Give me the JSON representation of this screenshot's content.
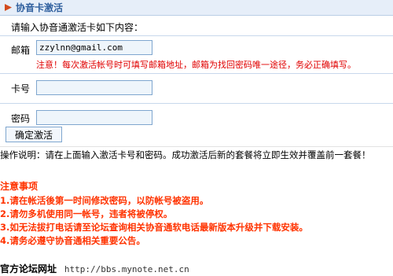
{
  "header": {
    "title": "协音卡激活"
  },
  "form": {
    "intro": "请输入协音通激活卡如下内容：",
    "email_label": "邮箱",
    "email_value": "zzylnn@gmail.com",
    "note": "注意！每次激活帐号时可填写邮箱地址，邮箱为找回密码唯一途径，务必正确填写。",
    "card_label": "卡号",
    "card_value": "",
    "password_label": "密码",
    "password_value": "",
    "submit_label": "确定激活"
  },
  "instructions": "操作说明：请在上面输入激活卡号和密码。成功激活后新的套餐将立即生效并覆盖前一套餐！",
  "notice": {
    "title": "注意事项",
    "items": [
      "1.请在帐活後第一时间修改密码，以防帐号被盗用。",
      "2.请勿多机使用同一帐号，违者将被停权。",
      "3.如无法拔打电话请至论坛查询相关协音通软电话最新版本升级并下载安装。",
      "4.请务必遵守协音通相关重要公告。"
    ]
  },
  "footer": {
    "forum_label": "官方论坛网址",
    "forum_url": "http://bbs.mynote.net.cn"
  },
  "colors": {
    "accent": "#2f5f9e",
    "warning": "#ff3300",
    "note": "#e00000"
  }
}
